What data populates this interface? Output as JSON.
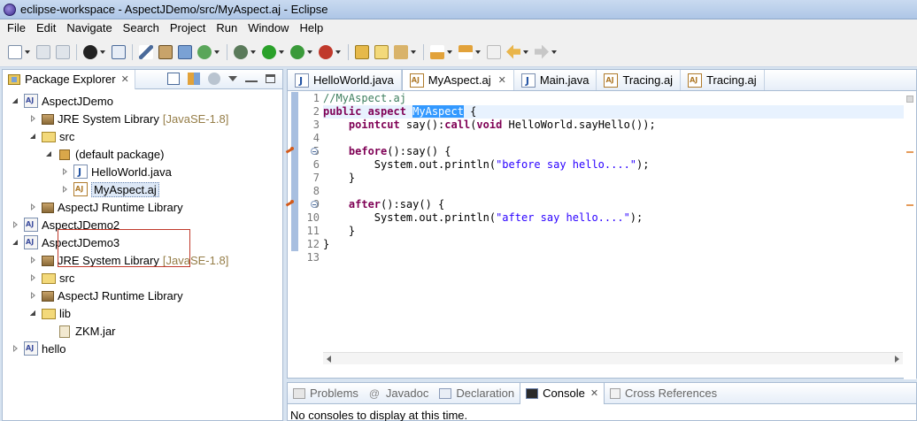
{
  "window": {
    "title": "eclipse-workspace - AspectJDemo/src/MyAspect.aj - Eclipse"
  },
  "menu": [
    "File",
    "Edit",
    "Navigate",
    "Search",
    "Project",
    "Run",
    "Window",
    "Help"
  ],
  "package_explorer": {
    "tab_label": "Package Explorer",
    "tree": [
      {
        "label": "AspectJDemo"
      },
      {
        "label": "JRE System Library",
        "suffix": "[JavaSE-1.8]"
      },
      {
        "label": "src"
      },
      {
        "label": "(default package)"
      },
      {
        "label": "HelloWorld.java"
      },
      {
        "label": "MyAspect.aj"
      },
      {
        "label": "AspectJ Runtime Library"
      },
      {
        "label": "AspectJDemo2"
      },
      {
        "label": "AspectJDemo3"
      },
      {
        "label": "JRE System Library",
        "suffix": "[JavaSE-1.8]"
      },
      {
        "label": "src"
      },
      {
        "label": "AspectJ Runtime Library"
      },
      {
        "label": "lib"
      },
      {
        "label": "ZKM.jar"
      },
      {
        "label": "hello"
      }
    ]
  },
  "editor": {
    "tabs": [
      {
        "label": "HelloWorld.java"
      },
      {
        "label": "MyAspect.aj"
      },
      {
        "label": "Main.java"
      },
      {
        "label": "Tracing.aj"
      },
      {
        "label": "Tracing.aj"
      }
    ],
    "line_numbers": [
      "1",
      "2",
      "3",
      "4",
      "5",
      "6",
      "7",
      "8",
      "9",
      "10",
      "11",
      "12",
      "13"
    ],
    "code": {
      "l1": "//MyAspect.aj",
      "l2_kw": "public aspect",
      "l2_sel": "MyAspect",
      "l2_rest": " {",
      "l3_kw": "pointcut",
      "l3_a": " say():",
      "l3_kw2": "call",
      "l3_b": "(",
      "l3_kw3": "void",
      "l3_c": " HelloWorld.sayHello());",
      "l5_kw": "before",
      "l5_rest": "():say() {",
      "l6_a": "System.out.println(",
      "l6_str": "\"before say hello....\"",
      "l6_b": ");",
      "l7": "}",
      "l9_kw": "after",
      "l9_rest": "():say() {",
      "l10_a": "System.out.println(",
      "l10_str": "\"after say hello....\"",
      "l10_b": ");",
      "l11": "}",
      "l12": "}"
    }
  },
  "bottom_panel": {
    "tabs": [
      "Problems",
      "Javadoc",
      "Declaration",
      "Console",
      "Cross References"
    ],
    "console_message": "No consoles to display at this time."
  },
  "colors": {
    "keyword": "#7f0055",
    "comment": "#3f7f5f",
    "string": "#2a00ff",
    "selection": "#3399ff",
    "highlight_box": "#c0392b"
  }
}
